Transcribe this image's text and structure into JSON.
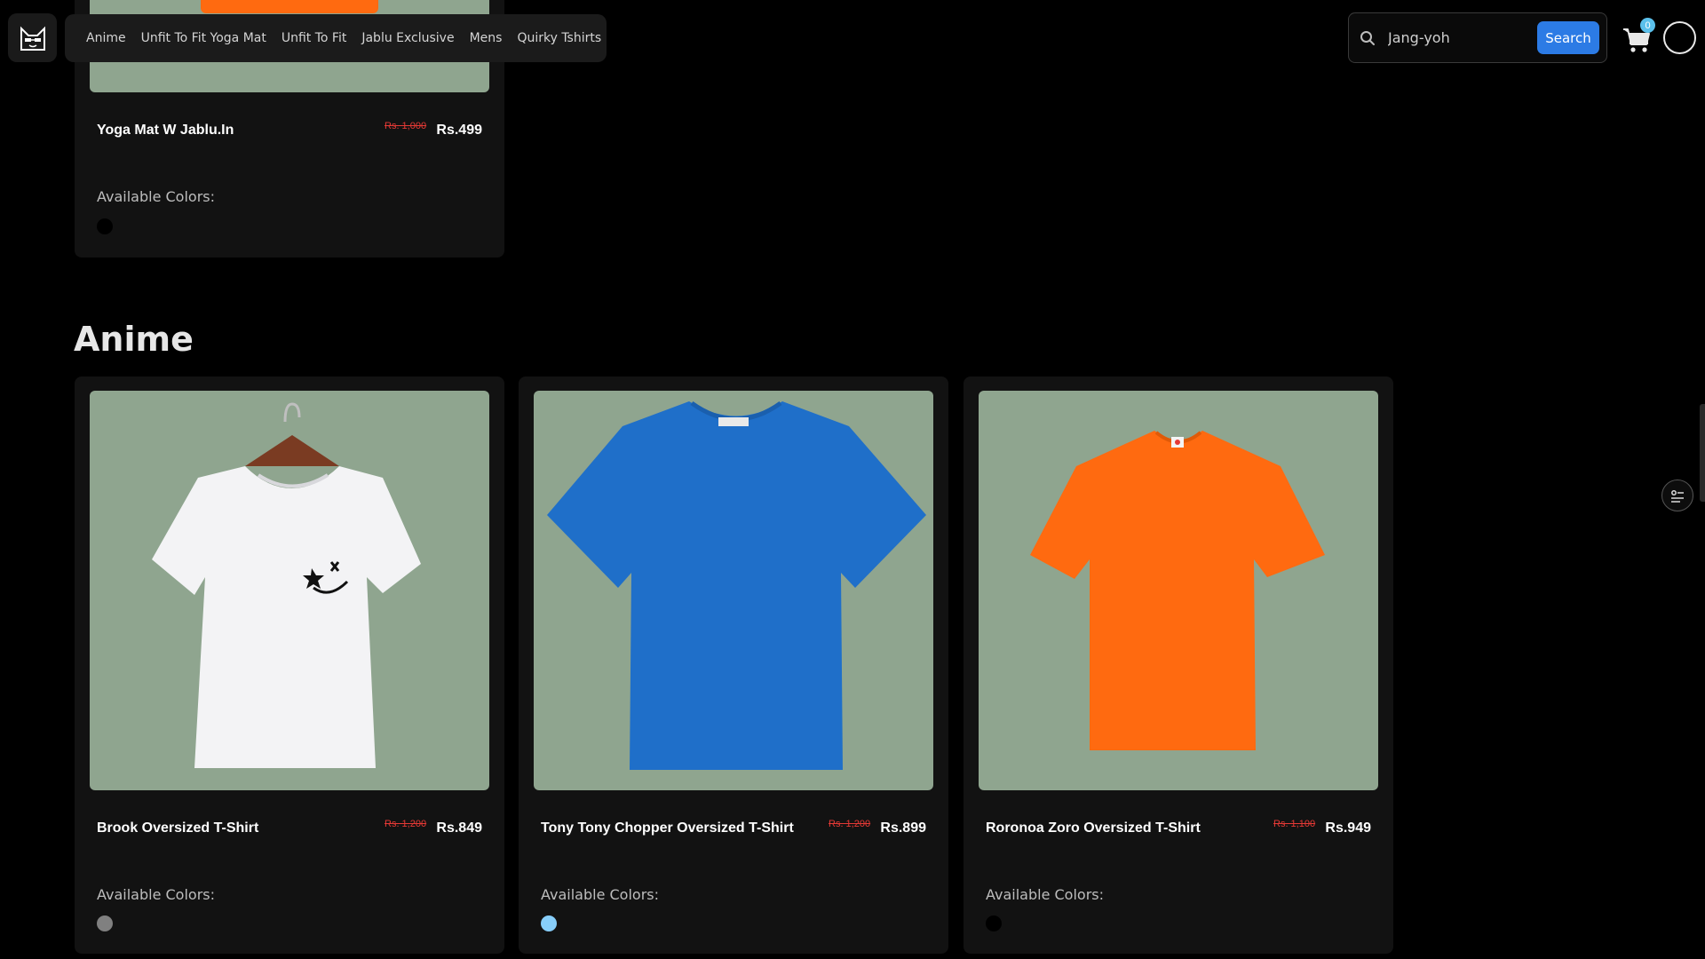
{
  "header": {
    "nav_items": [
      "Anime",
      "Unfit To Fit Yoga Mat",
      "Unfit To Fit",
      "Jablu Exclusive",
      "Mens",
      "Quirky Tshirts"
    ],
    "search": {
      "value": "Jang-yoh",
      "button_label": "Search"
    },
    "cart_count": "0"
  },
  "top_product": {
    "name": "Yoga Mat W Jablu.In",
    "old_price": "Rs. 1,000",
    "price": "Rs.499",
    "colors_label": "Available Colors:",
    "colors": [
      "#000000"
    ]
  },
  "section": {
    "title": "Anime",
    "products": [
      {
        "name": "Brook Oversized T-Shirt",
        "old_price": "Rs. 1,200",
        "price": "Rs.849",
        "colors_label": "Available Colors:",
        "colors": [
          "#808080"
        ],
        "shirt_color": "#f4f4f6"
      },
      {
        "name": "Tony Tony Chopper Oversized T-Shirt",
        "old_price": "Rs. 1,200",
        "price": "Rs.899",
        "colors_label": "Available Colors:",
        "colors": [
          "#87cefa"
        ],
        "shirt_color": "#1f6fc9"
      },
      {
        "name": "Roronoa Zoro Oversized T-Shirt",
        "old_price": "Rs. 1,100",
        "price": "Rs.949",
        "colors_label": "Available Colors:",
        "colors": [
          "#000000"
        ],
        "shirt_color": "#ff6a10"
      }
    ]
  }
}
